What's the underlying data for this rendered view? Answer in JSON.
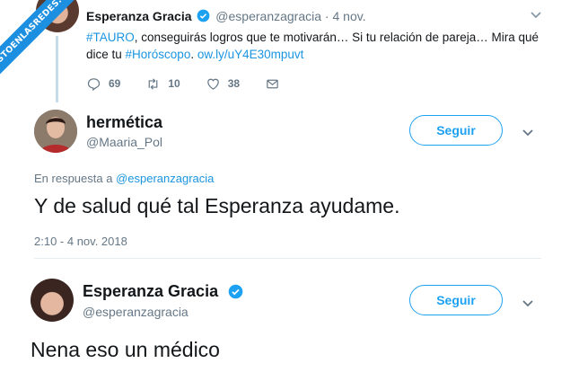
{
  "watermark": "VISTOENLASREDES.COM",
  "colors": {
    "accent": "#1da1f2",
    "link": "#1b95e0",
    "muted": "#657786",
    "text": "#14171a"
  },
  "tweet_parent": {
    "name": "Esperanza Gracia",
    "verified_icon": "verified-badge-icon",
    "handle": "@esperanzagracia",
    "separator": " · ",
    "date": "4 nov.",
    "hashtag1": "#TAURO",
    "text1": ", conseguirás logros que te motivarán… Si tu relación de pareja… Mira qué dice tu ",
    "hashtag2": "#Horóscopo",
    "text2": ". ",
    "link": "ow.ly/uY4E30mpuvt",
    "actions": {
      "replies": "69",
      "retweets": "10",
      "likes": "38"
    }
  },
  "tweet_reply": {
    "name": "hermética",
    "handle": "@Maaria_Pol",
    "follow_label": "Seguir",
    "reply_prefix": "En respuesta a ",
    "reply_to": "@esperanzagracia",
    "text": "Y de salud qué tal Esperanza ayudame.",
    "timestamp": "2:10 - 4 nov. 2018"
  },
  "tweet_answer": {
    "name": "Esperanza Gracia",
    "handle": "@esperanzagracia",
    "follow_label": "Seguir",
    "text": "Nena eso un médico"
  }
}
